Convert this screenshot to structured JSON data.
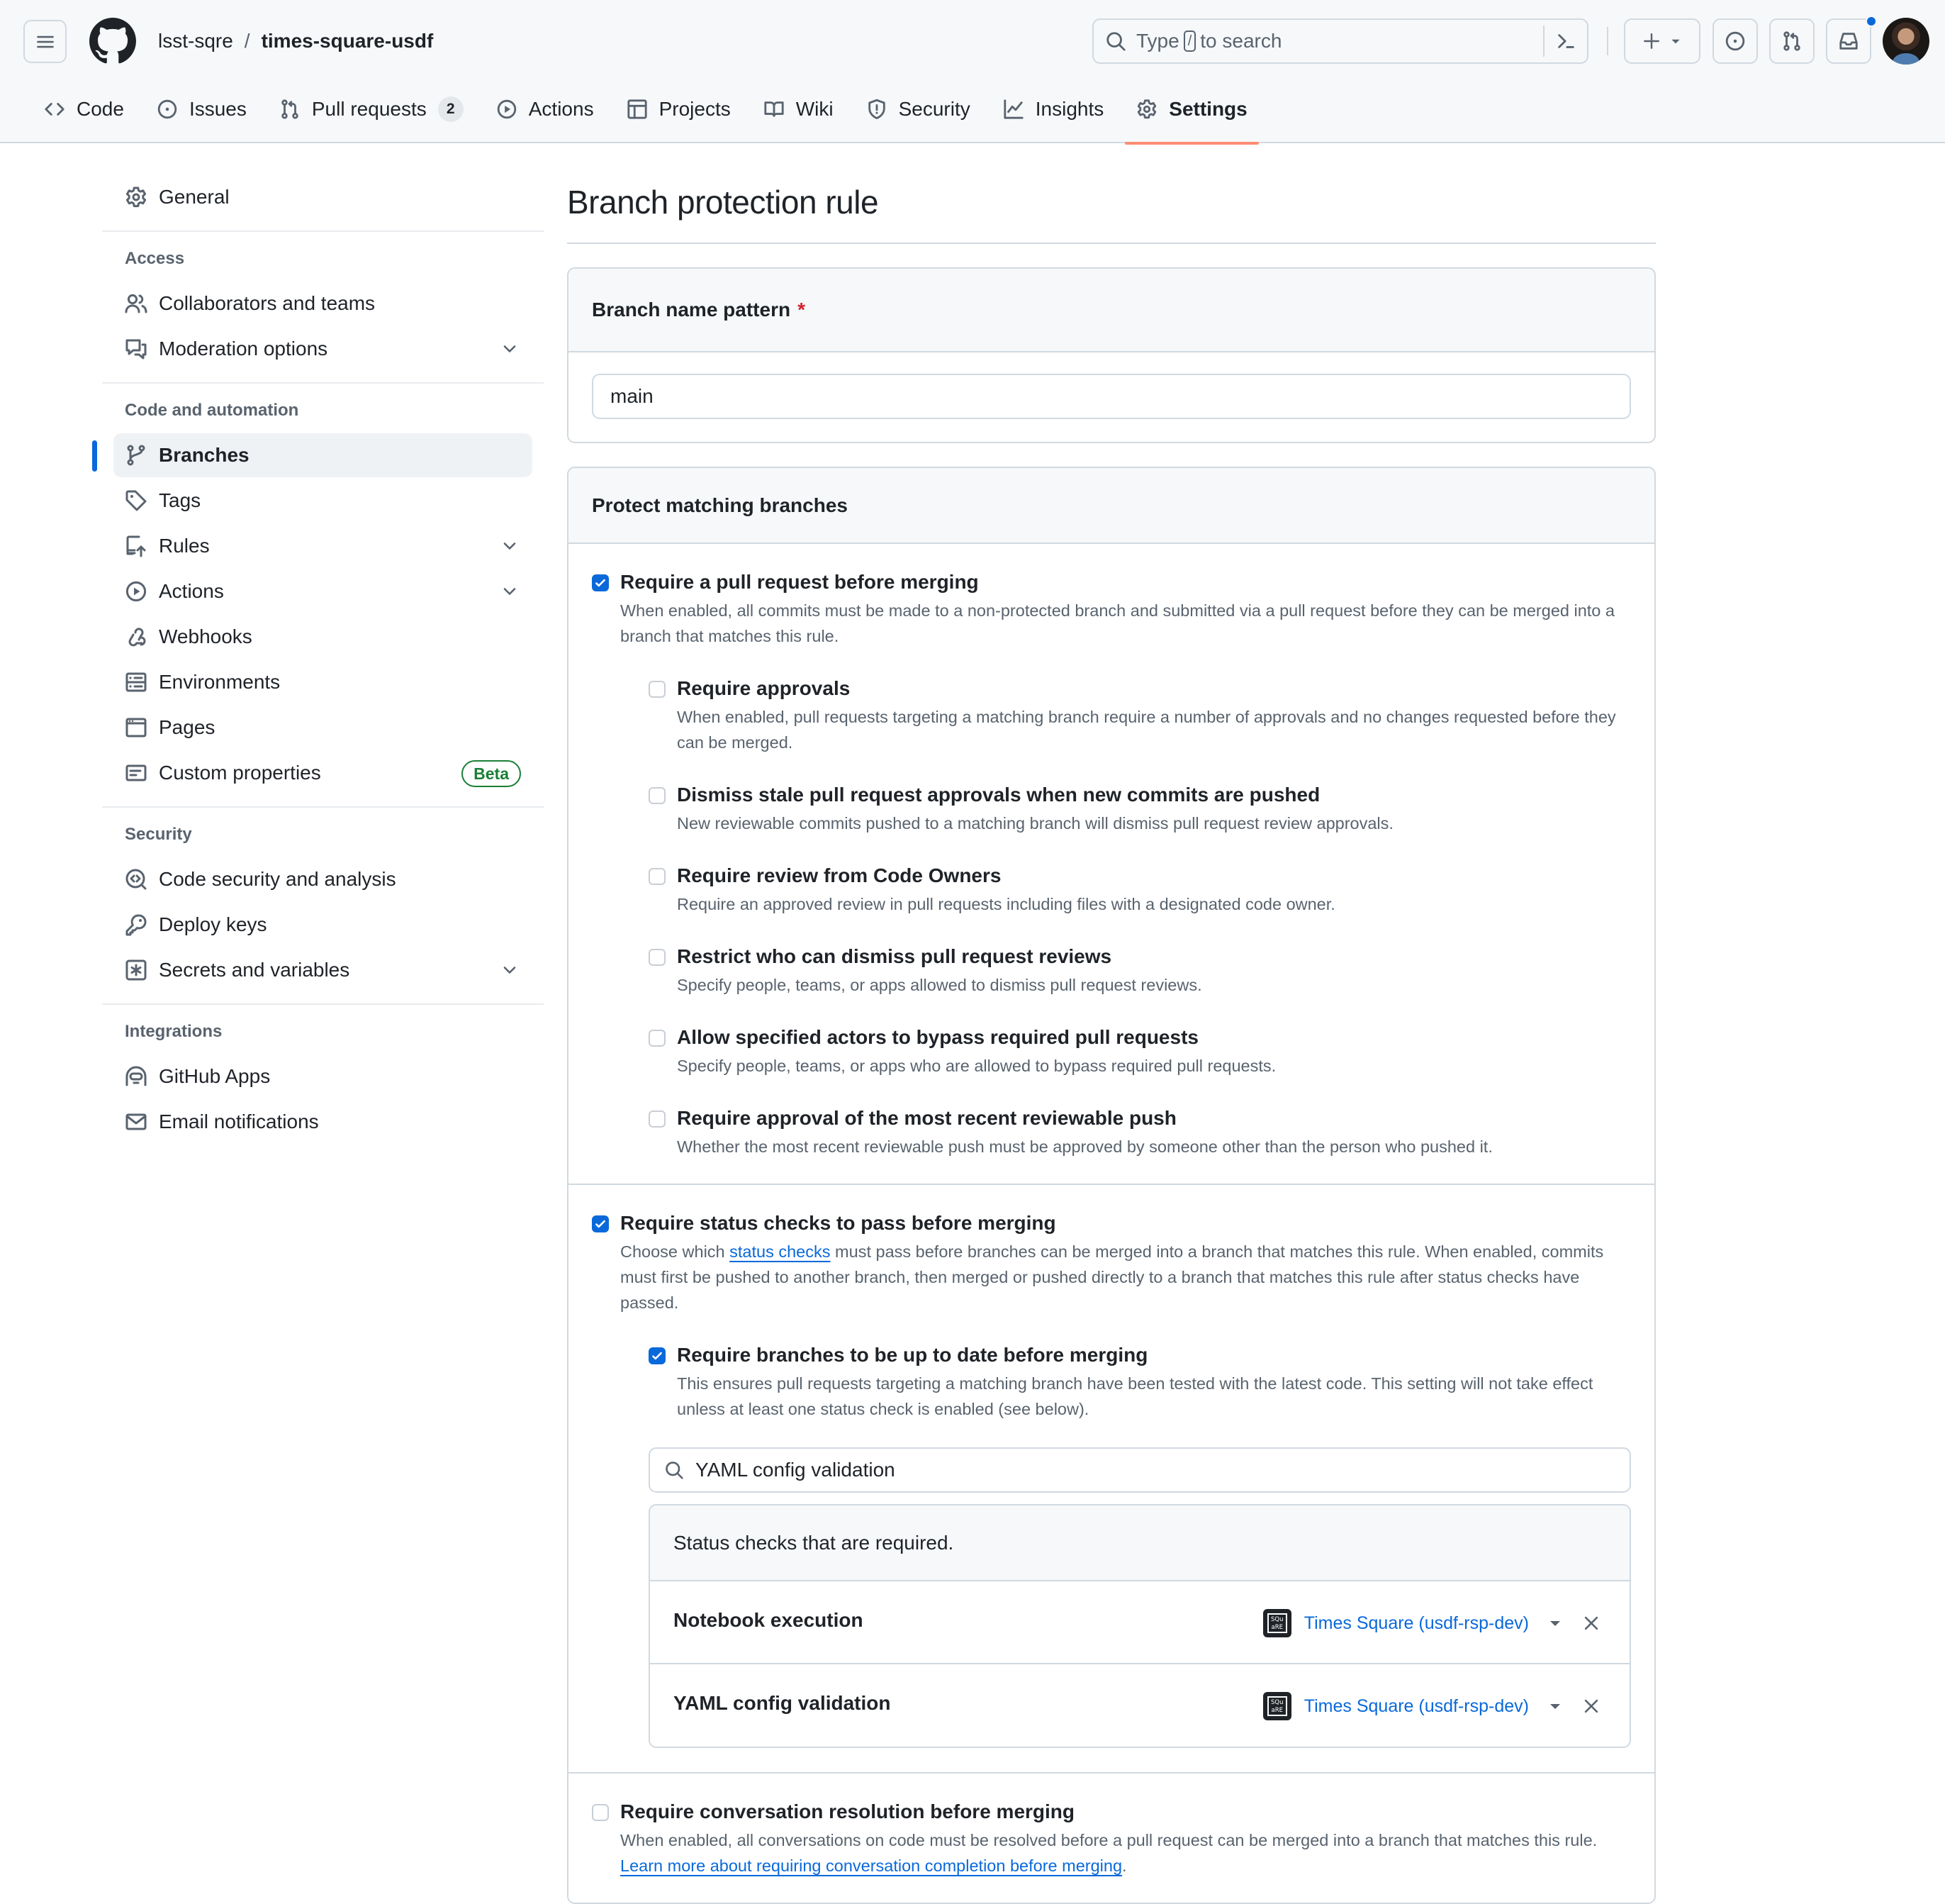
{
  "header": {
    "owner": "lsst-sqre",
    "separator": "/",
    "repo": "times-square-usdf",
    "search_placeholder_prefix": "Type",
    "search_key": "/",
    "search_placeholder_suffix": "to search"
  },
  "tabs": [
    {
      "label": "Code",
      "icon": "code-icon"
    },
    {
      "label": "Issues",
      "icon": "issue-icon"
    },
    {
      "label": "Pull requests",
      "icon": "pull-request-icon",
      "count": "2"
    },
    {
      "label": "Actions",
      "icon": "play-icon"
    },
    {
      "label": "Projects",
      "icon": "table-icon"
    },
    {
      "label": "Wiki",
      "icon": "book-icon"
    },
    {
      "label": "Security",
      "icon": "shield-icon"
    },
    {
      "label": "Insights",
      "icon": "graph-icon"
    },
    {
      "label": "Settings",
      "icon": "gear-icon",
      "active": true
    }
  ],
  "sidebar": {
    "general": "General",
    "sections": {
      "access": {
        "heading": "Access",
        "items": [
          "Collaborators and teams",
          "Moderation options"
        ]
      },
      "code": {
        "heading": "Code and automation",
        "items": [
          "Branches",
          "Tags",
          "Rules",
          "Actions",
          "Webhooks",
          "Environments",
          "Pages",
          "Custom properties"
        ],
        "beta_label": "Beta"
      },
      "security": {
        "heading": "Security",
        "items": [
          "Code security and analysis",
          "Deploy keys",
          "Secrets and variables"
        ]
      },
      "integrations": {
        "heading": "Integrations",
        "items": [
          "GitHub Apps",
          "Email notifications"
        ]
      }
    }
  },
  "main": {
    "title": "Branch protection rule",
    "pattern_box": {
      "label": "Branch name pattern",
      "required_mark": "*",
      "value": "main"
    },
    "protect_box": {
      "heading": "Protect matching branches",
      "require_pr": {
        "checked": true,
        "label": "Require a pull request before merging",
        "desc": "When enabled, all commits must be made to a non-protected branch and submitted via a pull request before they can be merged into a branch that matches this rule.",
        "sub_options": [
          {
            "checked": false,
            "label": "Require approvals",
            "desc": "When enabled, pull requests targeting a matching branch require a number of approvals and no changes requested before they can be merged."
          },
          {
            "checked": false,
            "label": "Dismiss stale pull request approvals when new commits are pushed",
            "desc": "New reviewable commits pushed to a matching branch will dismiss pull request review approvals."
          },
          {
            "checked": false,
            "label": "Require review from Code Owners",
            "desc": "Require an approved review in pull requests including files with a designated code owner."
          },
          {
            "checked": false,
            "label": "Restrict who can dismiss pull request reviews",
            "desc": "Specify people, teams, or apps allowed to dismiss pull request reviews."
          },
          {
            "checked": false,
            "label": "Allow specified actors to bypass required pull requests",
            "desc": "Specify people, teams, or apps who are allowed to bypass required pull requests."
          },
          {
            "checked": false,
            "label": "Require approval of the most recent reviewable push",
            "desc": "Whether the most recent reviewable push must be approved by someone other than the person who pushed it."
          }
        ]
      },
      "require_status": {
        "checked": true,
        "label": "Require status checks to pass before merging",
        "desc_prefix": "Choose which ",
        "desc_link": "status checks",
        "desc_suffix": " must pass before branches can be merged into a branch that matches this rule. When enabled, commits must first be pushed to another branch, then merged or pushed directly to a branch that matches this rule after status checks have passed.",
        "up_to_date": {
          "checked": true,
          "label": "Require branches to be up to date before merging",
          "desc": "This ensures pull requests targeting a matching branch have been tested with the latest code. This setting will not take effect unless at least one status check is enabled (see below)."
        },
        "search_value": "YAML config validation",
        "checks_heading": "Status checks that are required.",
        "checks": [
          {
            "name": "Notebook execution",
            "app": "Times Square (usdf-rsp-dev)",
            "app_logo_text": "SQu aRE"
          },
          {
            "name": "YAML config validation",
            "app": "Times Square (usdf-rsp-dev)",
            "app_logo_text": "SQu aRE"
          }
        ]
      },
      "conversation": {
        "checked": false,
        "label": "Require conversation resolution before merging",
        "desc": "When enabled, all conversations on code must be resolved before a pull request can be merged into a branch that matches this rule. ",
        "link": "Learn more about requiring conversation completion before merging",
        "desc_end": "."
      }
    }
  },
  "colors": {
    "accent": "#0969da",
    "active_tab_underline": "#fd8c73",
    "beta": "#1a7f37",
    "required": "#d1242f"
  }
}
